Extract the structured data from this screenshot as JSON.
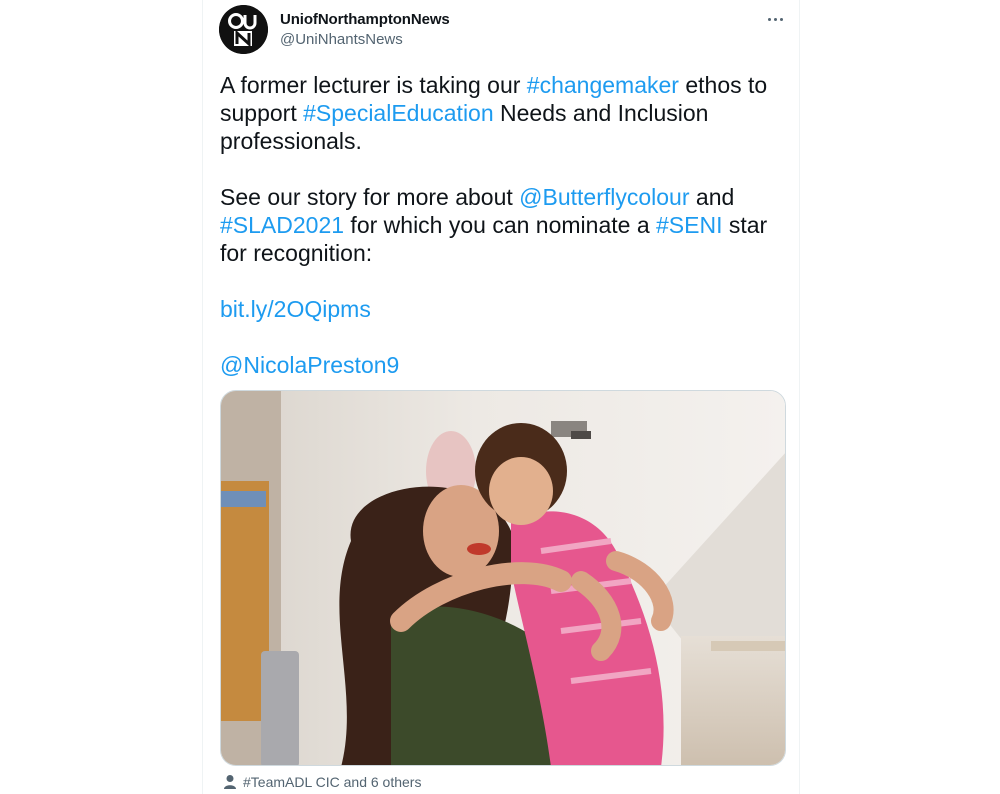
{
  "tweet": {
    "display_name": "UniofNorthamptonNews",
    "handle": "@UniNhantsNews",
    "avatar_icon": "uon-logo-icon",
    "more_icon": "more-options-icon",
    "body": {
      "p1_t1": "A former lecturer is taking our ",
      "p1_l1": "#changemaker",
      "p1_t2": " ethos to support ",
      "p1_l2": "#SpecialEducation",
      "p1_t3": " Needs and Inclusion professionals.",
      "p2_t1": "See our story for more about ",
      "p2_l1": "@Butterflycolour",
      "p2_t2": " and ",
      "p2_l2": "#SLAD2021",
      "p2_t3": " for which you can nominate a ",
      "p2_l3": "#SENI",
      "p2_t4": " star for recognition:",
      "link": "bit.ly/2OQipms",
      "mention": "@NicolaPreston9"
    },
    "tagged_people": "#TeamADL CIC and 6 others",
    "tagged_icon": "person-icon",
    "colors": {
      "link": "#1d9bf0",
      "text": "#0f1419",
      "secondary": "#536471"
    }
  }
}
